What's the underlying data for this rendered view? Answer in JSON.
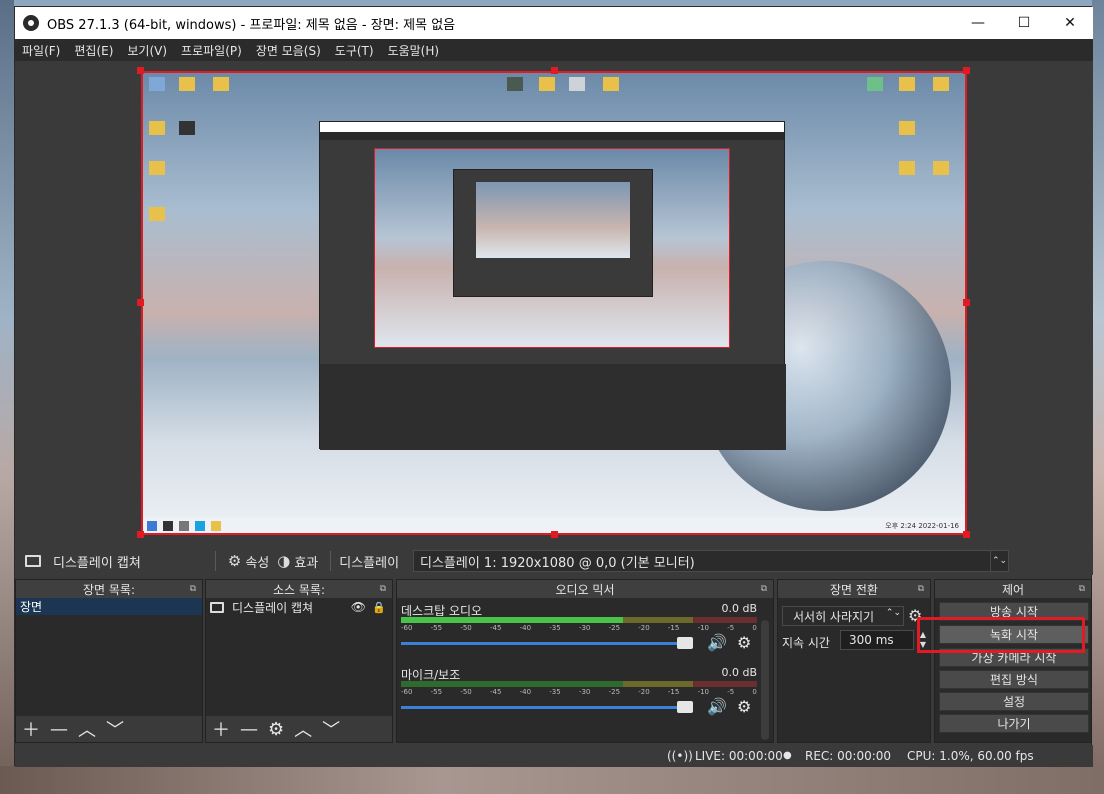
{
  "window": {
    "title": "OBS 27.1.3 (64-bit, windows) - 프로파일: 제목 없음 - 장면: 제목 없음",
    "minimize": "—",
    "maximize": "☐",
    "close": "✕"
  },
  "menu": [
    "파일(F)",
    "편집(E)",
    "보기(V)",
    "프로파일(P)",
    "장면 모음(S)",
    "도구(T)",
    "도움말(H)"
  ],
  "toolbar": {
    "source_name": "디스플레이 캡쳐",
    "properties": "속성",
    "filters": "효과",
    "display_label": "디스플레이",
    "display_value": "디스플레이 1: 1920x1080 @ 0,0 (기본 모니터)"
  },
  "scenes": {
    "title": "장면 목록:",
    "items": [
      "장면"
    ]
  },
  "sources": {
    "title": "소스 목록:",
    "items": [
      "디스플레이 캡쳐"
    ]
  },
  "mixer": {
    "title": "오디오 믹서",
    "channels": [
      {
        "name": "데스크탑 오디오",
        "db": "0.0 dB"
      },
      {
        "name": "마이크/보조",
        "db": "0.0 dB"
      }
    ],
    "ticks": [
      "-60",
      "-55",
      "-50",
      "-45",
      "-40",
      "-35",
      "-30",
      "-25",
      "-20",
      "-15",
      "-10",
      "-5",
      "0"
    ]
  },
  "transitions": {
    "title": "장면 전환",
    "type": "서서히 사라지기",
    "duration_label": "지속 시간",
    "duration_value": "300 ms"
  },
  "controls": {
    "title": "제어",
    "start_streaming": "방송 시작",
    "start_recording": "녹화 시작",
    "virtual_camera": "가상 카메라 시작",
    "studio_mode": "편집 방식",
    "settings": "설정",
    "exit": "나가기"
  },
  "status": {
    "live": "LIVE: 00:00:00",
    "rec": "REC: 00:00:00",
    "cpu": "CPU: 1.0%, 60.00 fps"
  },
  "preview_taskbar_clock": "오후 2:24\n2022-01-16"
}
